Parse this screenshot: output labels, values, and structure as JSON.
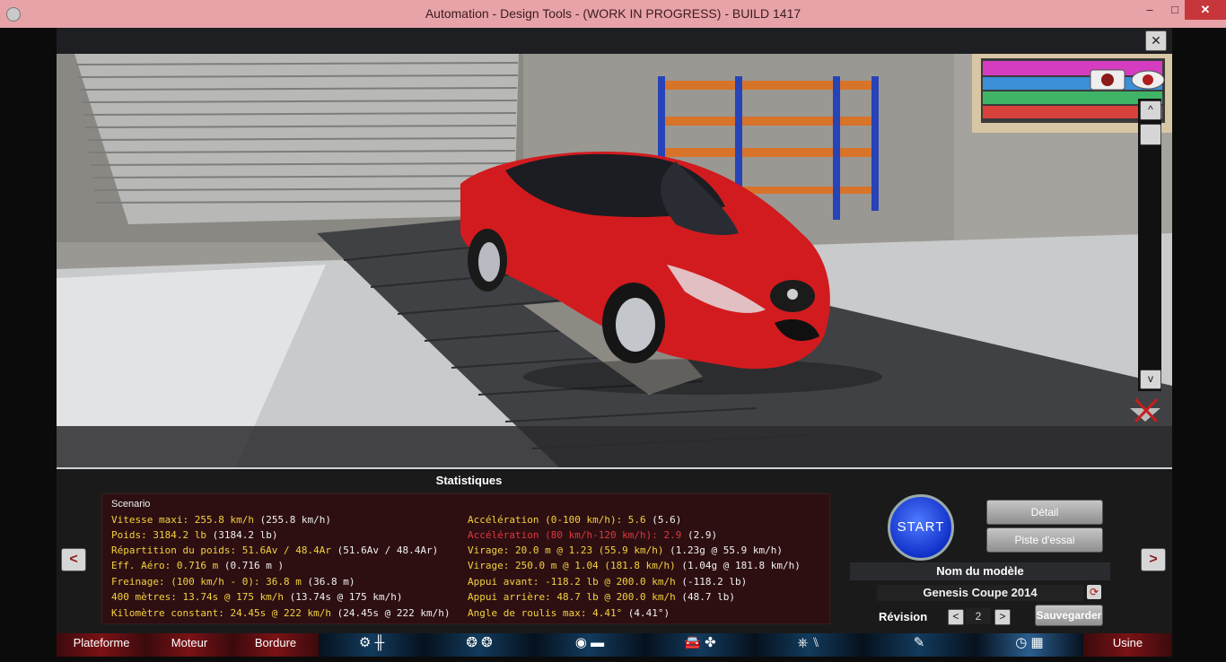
{
  "window": {
    "title": "Automation - Design Tools - (WORK IN PROGRESS) - BUILD 1417",
    "minimize_label": "–",
    "maximize_label": "□",
    "close_label": "✕"
  },
  "viewport": {
    "close_label": "✕",
    "scroll_up_label": "^",
    "scroll_down_label": "v"
  },
  "stats": {
    "title": "Statistiques",
    "scenario_label": "Scenario",
    "left": [
      {
        "label": "Vitesse maxi: 255.8 km/h",
        "value": " (255.8 km/h)",
        "color": "yellow"
      },
      {
        "label": "Poids: 3184.2 lb",
        "value": " (3184.2 lb)",
        "color": "yellow"
      },
      {
        "label": "Répartition du poids: 51.6Av / 48.4Ar",
        "value": " (51.6Av / 48.4Ar)",
        "color": "yellow"
      },
      {
        "label": "Eff. Aéro: 0.716 m",
        "value": "  (0.716 m )",
        "color": "yellow"
      },
      {
        "label": "Freinage: (100 km/h - 0): 36.8 m",
        "value": "  (36.8 m)",
        "color": "yellow"
      },
      {
        "label": "400 mètres: 13.74s @ 175 km/h",
        "value": " (13.74s @ 175 km/h)",
        "color": "yellow"
      },
      {
        "label": "Kilomètre constant: 24.45s @ 222 km/h",
        "value": " (24.45s @ 222 km/h)",
        "color": "yellow"
      }
    ],
    "right": [
      {
        "label": "Accélération (0-100 km/h): 5.6",
        "value": " (5.6)",
        "color": "yellow"
      },
      {
        "label": "Accélération (80 km/h-120 km/h): 2.9",
        "value": " (2.9)",
        "color": "red"
      },
      {
        "label": "Virage: 20.0 m @ 1.23 (55.9 km/h)",
        "value": " (1.23g @ 55.9 km/h)",
        "color": "yellow"
      },
      {
        "label": "Virage: 250.0 m @ 1.04 (181.8 km/h)",
        "value": " (1.04g @ 181.8 km/h)",
        "color": "yellow"
      },
      {
        "label": "Appui avant: -118.2 lb @ 200.0 km/h",
        "value": " (-118.2 lb)",
        "color": "yellow"
      },
      {
        "label": "Appui arrière: 48.7 lb @ 200.0 km/h",
        "value": " (48.7 lb)",
        "color": "yellow"
      },
      {
        "label": "Angle de roulis max: 4.41°",
        "value": " (4.41°)",
        "color": "yellow"
      }
    ]
  },
  "controls": {
    "start_label": "START",
    "detail_label": "Détail",
    "test_track_label": "Piste d'essai",
    "model_name_header": "Nom du modèle",
    "model_name": "Genesis Coupe  2014",
    "revision_label": "Révision",
    "revision_value": "2",
    "revision_prev": "<",
    "revision_next": ">",
    "save_label": "Sauvegarder",
    "side_prev": "<",
    "side_next": ">"
  },
  "nav": {
    "tabs": [
      {
        "label": "Plateforme"
      },
      {
        "label": "Moteur"
      },
      {
        "label": "Bordure"
      },
      {
        "label": "",
        "icon": "engine-gearbox-icon"
      },
      {
        "label": "",
        "icon": "suspension-icon"
      },
      {
        "label": "",
        "icon": "drivetrain-icon"
      },
      {
        "label": "",
        "icon": "body-aero-icon"
      },
      {
        "label": "",
        "icon": "interior-icon"
      },
      {
        "label": "",
        "icon": "tools-icon"
      },
      {
        "label": "",
        "icon": "test-flag-icon"
      },
      {
        "label": "Usine"
      }
    ]
  },
  "colors": {
    "stat_yellow": "#f3d23c",
    "stat_red": "#e0373b",
    "car_red": "#d21b1e",
    "start_blue": "#1131c9",
    "titlebar_pink": "#e8a3a8"
  }
}
